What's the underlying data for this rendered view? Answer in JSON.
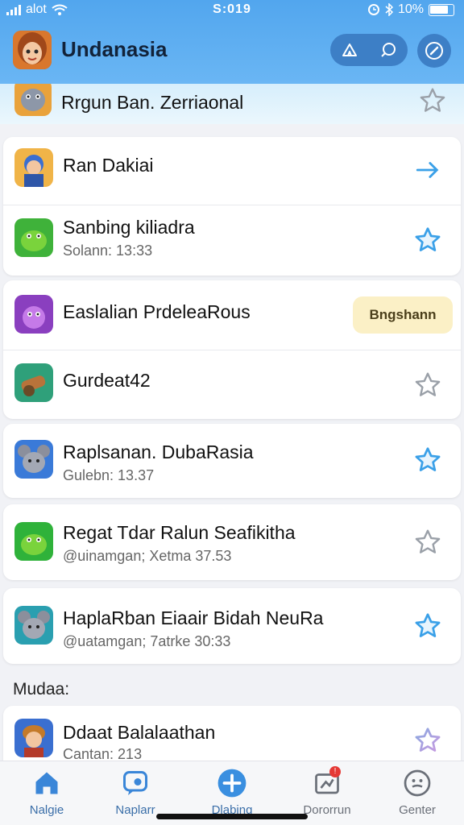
{
  "status_bar": {
    "carrier": "alot",
    "time": "S:019",
    "battery": "10%"
  },
  "header": {
    "title": "Undanasia"
  },
  "colors": {
    "header_blue": "#52a6ee",
    "star_blue": "#3aa0e8",
    "star_gray": "#9aa0a8",
    "badge_bg": "#fbf0c6"
  },
  "list": {
    "top_item": {
      "title": "Rrgun Ban. Zerriaonal",
      "icon": "hippo-avatar-icon",
      "action": "star-outline-icon"
    },
    "card1": [
      {
        "title": "Ran Dakiai",
        "icon": "warrior-avatar-icon",
        "action": "arrow-right-icon"
      },
      {
        "title": "Sanbing kiliadra",
        "subtitle": "Solann: 13:33",
        "icon": "green-creature-icon",
        "action": "star-filled-icon"
      }
    ],
    "card2": [
      {
        "title": "Easlalian PrdeleaRous",
        "icon": "purple-creature-icon",
        "badge": "Bngshann"
      },
      {
        "title": "Gurdeat42",
        "icon": "cannon-icon",
        "action": "star-outline-icon"
      }
    ],
    "card3": {
      "title": "Raplsanan. DubaRasia",
      "subtitle": "Gulebn: 13.37",
      "icon": "mouse-avatar-icon",
      "action": "star-filled-icon"
    },
    "card4": {
      "title": "Regat Tdar Ralun Seafikitha",
      "subtitle": "@uinamgan; Xetma 37.53",
      "icon": "green-creature-icon",
      "action": "star-outline-icon"
    },
    "card5": {
      "title": "HaplaRban Eiaair Bidah NeuRa",
      "subtitle": "@uatamgan; 7atrke 30:33",
      "icon": "mouse-avatar-icon",
      "action": "star-filled-icon"
    },
    "section_label": "Mudaa:",
    "card6": {
      "title": "Ddaat Balalaathan",
      "subtitle": "Cantan: 213",
      "icon": "hero-avatar-icon",
      "action": "star-outline-icon"
    }
  },
  "tabbar": {
    "tabs": [
      {
        "label": "Nalgie",
        "icon": "home-icon",
        "active": true
      },
      {
        "label": "Naplarr",
        "icon": "chat-icon",
        "active": true
      },
      {
        "label": "Dlabing",
        "icon": "plus-circle-icon",
        "active": true
      },
      {
        "label": "Dororrun",
        "icon": "map-icon",
        "active": false
      },
      {
        "label": "Genter",
        "icon": "face-icon",
        "active": false
      }
    ],
    "notification_count": "!"
  }
}
